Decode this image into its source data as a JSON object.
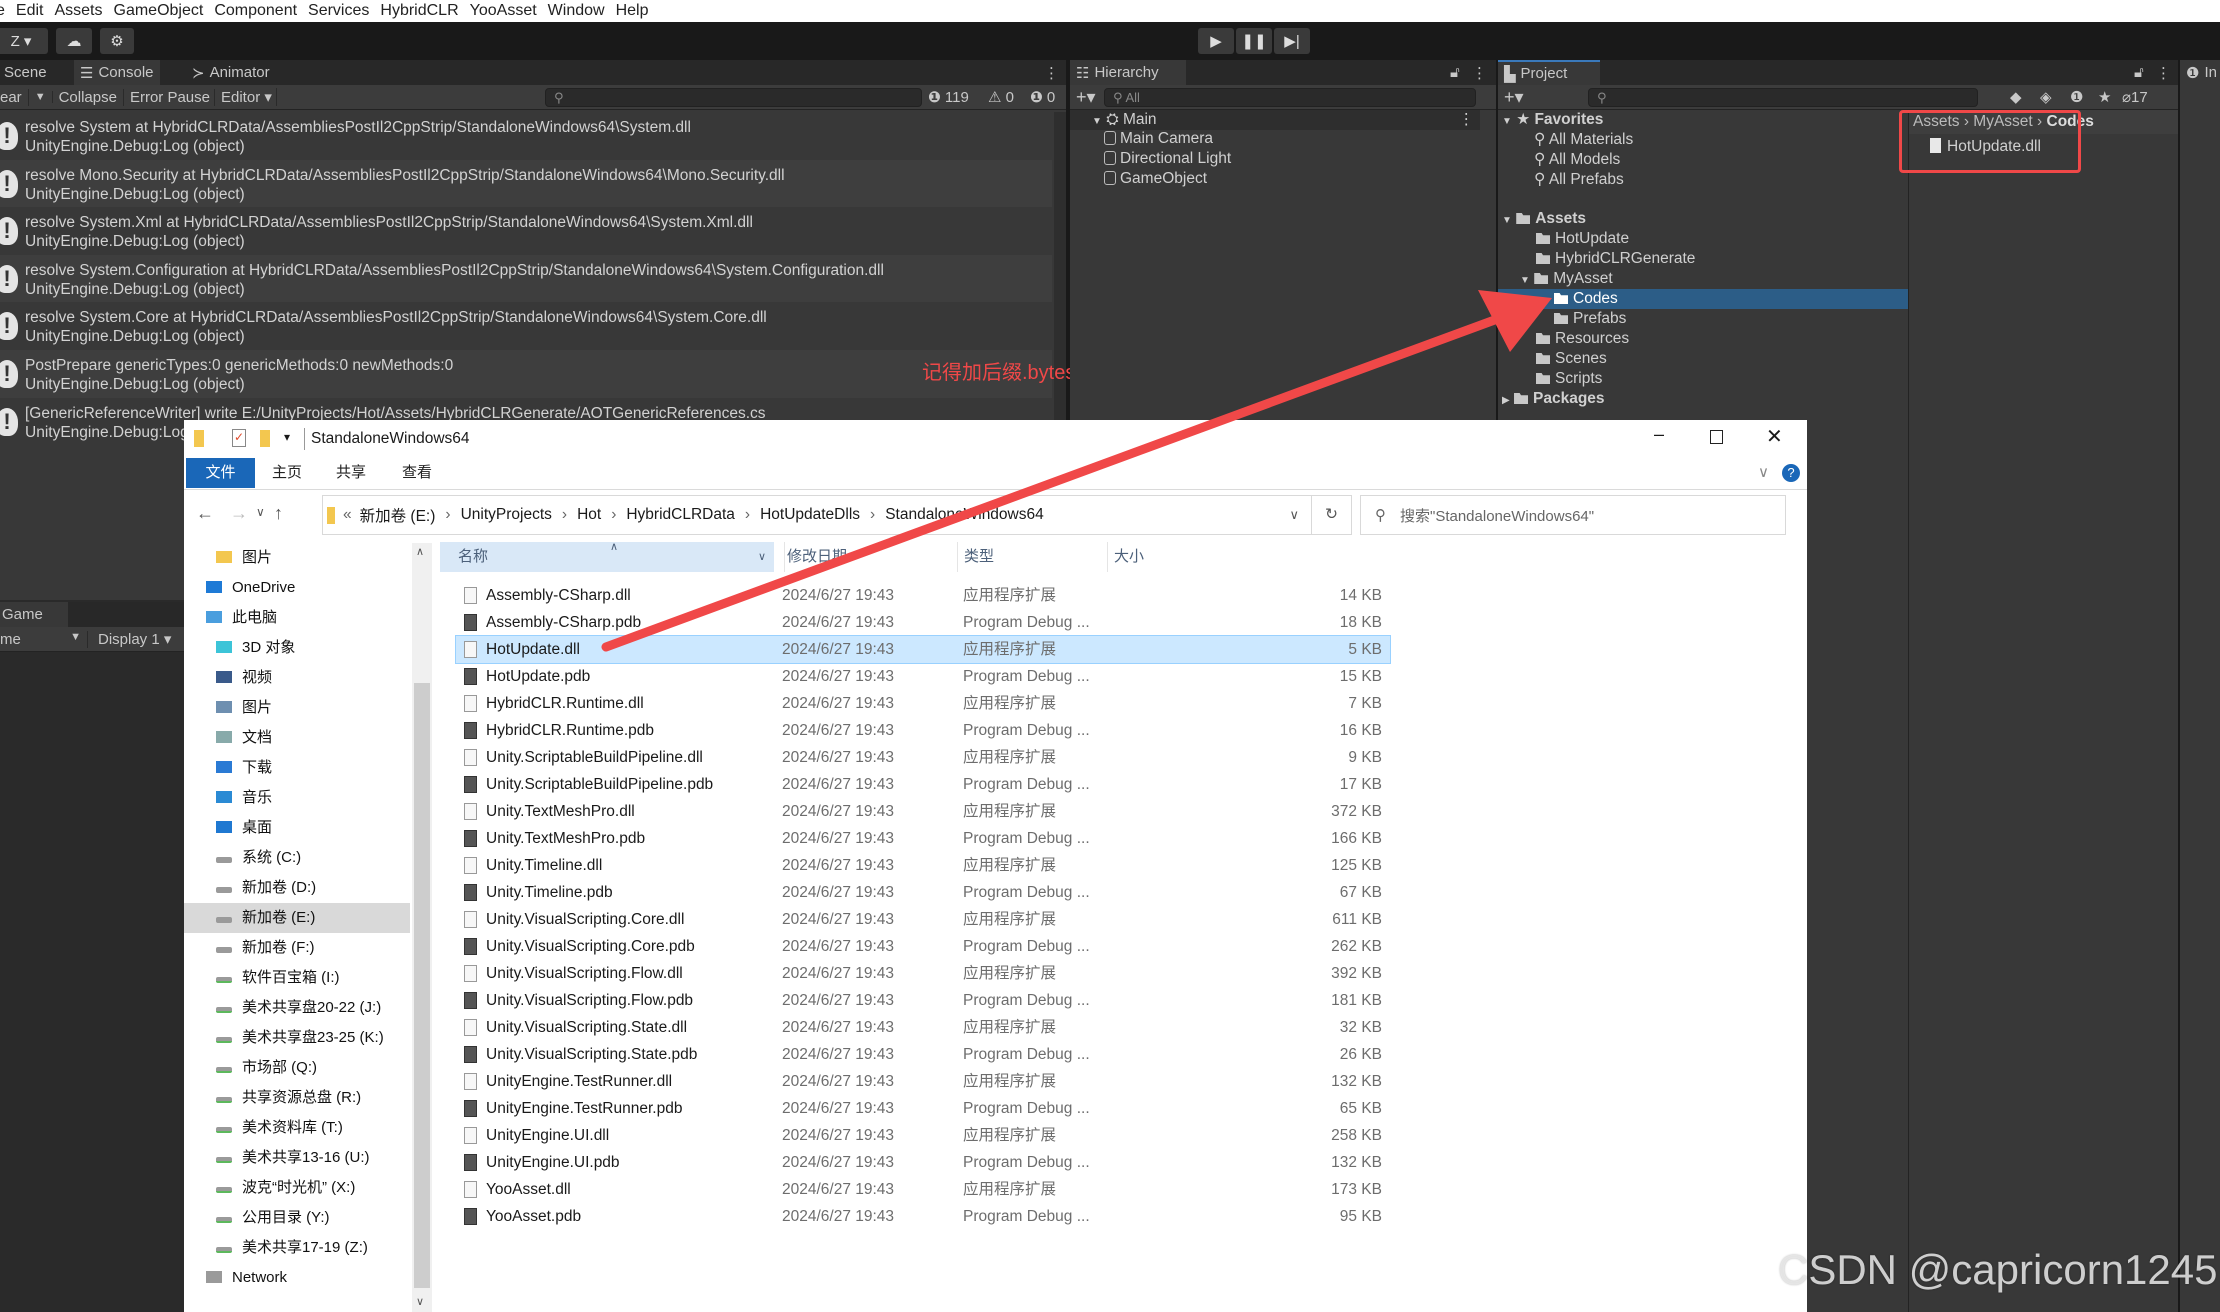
{
  "unity": {
    "menu": [
      "e",
      "Edit",
      "Assets",
      "GameObject",
      "Component",
      "Services",
      "HybridCLR",
      "YooAsset",
      "Window",
      "Help"
    ],
    "toolbar": {
      "account": "Z ▾"
    },
    "console": {
      "tabs": [
        "Scene",
        "Console",
        "Animator"
      ],
      "toolbar": {
        "clear": "ear",
        "collapse": "Collapse",
        "error_pause": "Error Pause",
        "editor": "Editor"
      },
      "counts": {
        "logs": "119",
        "warnings": "0",
        "errors": "0"
      },
      "rows": [
        {
          "msg": "resolve System at HybridCLRData/AssembliesPostIl2CppStrip/StandaloneWindows64\\System.dll",
          "trace": "UnityEngine.Debug:Log (object)"
        },
        {
          "msg": "resolve Mono.Security at HybridCLRData/AssembliesPostIl2CppStrip/StandaloneWindows64\\Mono.Security.dll",
          "trace": "UnityEngine.Debug:Log (object)"
        },
        {
          "msg": "resolve System.Xml at HybridCLRData/AssembliesPostIl2CppStrip/StandaloneWindows64\\System.Xml.dll",
          "trace": "UnityEngine.Debug:Log (object)"
        },
        {
          "msg": "resolve System.Configuration at HybridCLRData/AssembliesPostIl2CppStrip/StandaloneWindows64\\System.Configuration.dll",
          "trace": "UnityEngine.Debug:Log (object)"
        },
        {
          "msg": "resolve System.Core at HybridCLRData/AssembliesPostIl2CppStrip/StandaloneWindows64\\System.Core.dll",
          "trace": "UnityEngine.Debug:Log (object)"
        },
        {
          "msg": "PostPrepare genericTypes:0 genericMethods:0 newMethods:0",
          "trace": "UnityEngine.Debug:Log (object)"
        },
        {
          "msg": "[GenericReferenceWriter] write E:/UnityProjects/Hot/Assets/HybridCLRGenerate/AOTGenericReferences.cs",
          "trace": "UnityEngine.Debug:Log (object)"
        }
      ]
    },
    "annotation": "记得加后缀.bytes",
    "game": {
      "tab": "Game",
      "view": "me",
      "display": "Display 1"
    },
    "hierarchy": {
      "tab": "Hierarchy",
      "search": "All",
      "scene": "Main",
      "items": [
        "Main Camera",
        "Directional Light",
        "GameObject"
      ]
    },
    "project": {
      "tab": "Project",
      "hidden_count": "17",
      "favorites": {
        "label": "Favorites",
        "items": [
          "All Materials",
          "All Models",
          "All Prefabs"
        ]
      },
      "assets": {
        "label": "Assets",
        "items": [
          "HotUpdate",
          "HybridCLRGenerate",
          "MyAsset",
          "Codes",
          "Prefabs",
          "Resources",
          "Scenes",
          "Scripts"
        ]
      },
      "packages": "Packages",
      "breadcrumb": [
        "Assets",
        "MyAsset",
        "Codes"
      ],
      "files": [
        "HotUpdate.dll"
      ]
    },
    "inspector_tab": "In"
  },
  "explorer": {
    "title": "StandaloneWindows64",
    "ribbon": [
      "文件",
      "主页",
      "共享",
      "查看"
    ],
    "path": [
      "新加卷 (E:)",
      "UnityProjects",
      "Hot",
      "HybridCLRData",
      "HotUpdateDlls",
      "StandaloneWindows64"
    ],
    "search_placeholder": "搜索\"StandaloneWindows64\"",
    "nav": [
      "图片",
      "OneDrive",
      "此电脑",
      "3D 对象",
      "视频",
      "图片",
      "文档",
      "下载",
      "音乐",
      "桌面",
      "系统 (C:)",
      "新加卷 (D:)",
      "新加卷 (E:)",
      "新加卷 (F:)",
      "软件百宝箱 (I:)",
      "美术共享盘20-22 (J:)",
      "美术共享盘23-25 (K:)",
      "市场部 (Q:)",
      "共享资源总盘 (R:)",
      "美术资料库 (T:)",
      "美术共享13-16 (U:)",
      "波克“时光机” (X:)",
      "公用目录 (Y:)",
      "美术共享17-19 (Z:)",
      "Network"
    ],
    "columns": [
      "名称",
      "修改日期",
      "类型",
      "大小"
    ],
    "files": [
      {
        "name": "Assembly-CSharp.dll",
        "date": "2024/6/27 19:43",
        "type": "应用程序扩展",
        "size": "14 KB"
      },
      {
        "name": "Assembly-CSharp.pdb",
        "date": "2024/6/27 19:43",
        "type": "Program Debug ...",
        "size": "18 KB"
      },
      {
        "name": "HotUpdate.dll",
        "date": "2024/6/27 19:43",
        "type": "应用程序扩展",
        "size": "5 KB"
      },
      {
        "name": "HotUpdate.pdb",
        "date": "2024/6/27 19:43",
        "type": "Program Debug ...",
        "size": "15 KB"
      },
      {
        "name": "HybridCLR.Runtime.dll",
        "date": "2024/6/27 19:43",
        "type": "应用程序扩展",
        "size": "7 KB"
      },
      {
        "name": "HybridCLR.Runtime.pdb",
        "date": "2024/6/27 19:43",
        "type": "Program Debug ...",
        "size": "16 KB"
      },
      {
        "name": "Unity.ScriptableBuildPipeline.dll",
        "date": "2024/6/27 19:43",
        "type": "应用程序扩展",
        "size": "9 KB"
      },
      {
        "name": "Unity.ScriptableBuildPipeline.pdb",
        "date": "2024/6/27 19:43",
        "type": "Program Debug ...",
        "size": "17 KB"
      },
      {
        "name": "Unity.TextMeshPro.dll",
        "date": "2024/6/27 19:43",
        "type": "应用程序扩展",
        "size": "372 KB"
      },
      {
        "name": "Unity.TextMeshPro.pdb",
        "date": "2024/6/27 19:43",
        "type": "Program Debug ...",
        "size": "166 KB"
      },
      {
        "name": "Unity.Timeline.dll",
        "date": "2024/6/27 19:43",
        "type": "应用程序扩展",
        "size": "125 KB"
      },
      {
        "name": "Unity.Timeline.pdb",
        "date": "2024/6/27 19:43",
        "type": "Program Debug ...",
        "size": "67 KB"
      },
      {
        "name": "Unity.VisualScripting.Core.dll",
        "date": "2024/6/27 19:43",
        "type": "应用程序扩展",
        "size": "611 KB"
      },
      {
        "name": "Unity.VisualScripting.Core.pdb",
        "date": "2024/6/27 19:43",
        "type": "Program Debug ...",
        "size": "262 KB"
      },
      {
        "name": "Unity.VisualScripting.Flow.dll",
        "date": "2024/6/27 19:43",
        "type": "应用程序扩展",
        "size": "392 KB"
      },
      {
        "name": "Unity.VisualScripting.Flow.pdb",
        "date": "2024/6/27 19:43",
        "type": "Program Debug ...",
        "size": "181 KB"
      },
      {
        "name": "Unity.VisualScripting.State.dll",
        "date": "2024/6/27 19:43",
        "type": "应用程序扩展",
        "size": "32 KB"
      },
      {
        "name": "Unity.VisualScripting.State.pdb",
        "date": "2024/6/27 19:43",
        "type": "Program Debug ...",
        "size": "26 KB"
      },
      {
        "name": "UnityEngine.TestRunner.dll",
        "date": "2024/6/27 19:43",
        "type": "应用程序扩展",
        "size": "132 KB"
      },
      {
        "name": "UnityEngine.TestRunner.pdb",
        "date": "2024/6/27 19:43",
        "type": "Program Debug ...",
        "size": "65 KB"
      },
      {
        "name": "UnityEngine.UI.dll",
        "date": "2024/6/27 19:43",
        "type": "应用程序扩展",
        "size": "258 KB"
      },
      {
        "name": "UnityEngine.UI.pdb",
        "date": "2024/6/27 19:43",
        "type": "Program Debug ...",
        "size": "132 KB"
      },
      {
        "name": "YooAsset.dll",
        "date": "2024/6/27 19:43",
        "type": "应用程序扩展",
        "size": "173 KB"
      },
      {
        "name": "YooAsset.pdb",
        "date": "2024/6/27 19:43",
        "type": "Program Debug ...",
        "size": "95 KB"
      }
    ],
    "selected_file": "HotUpdate.dll",
    "selected_nav": "新加卷 (E:)"
  },
  "watermark": "CSDN @capricorn1245",
  "colors": {
    "annotation_red": "#f04848",
    "selection_blue": "#2c5d87",
    "explorer_accent": "#1a67b8"
  }
}
